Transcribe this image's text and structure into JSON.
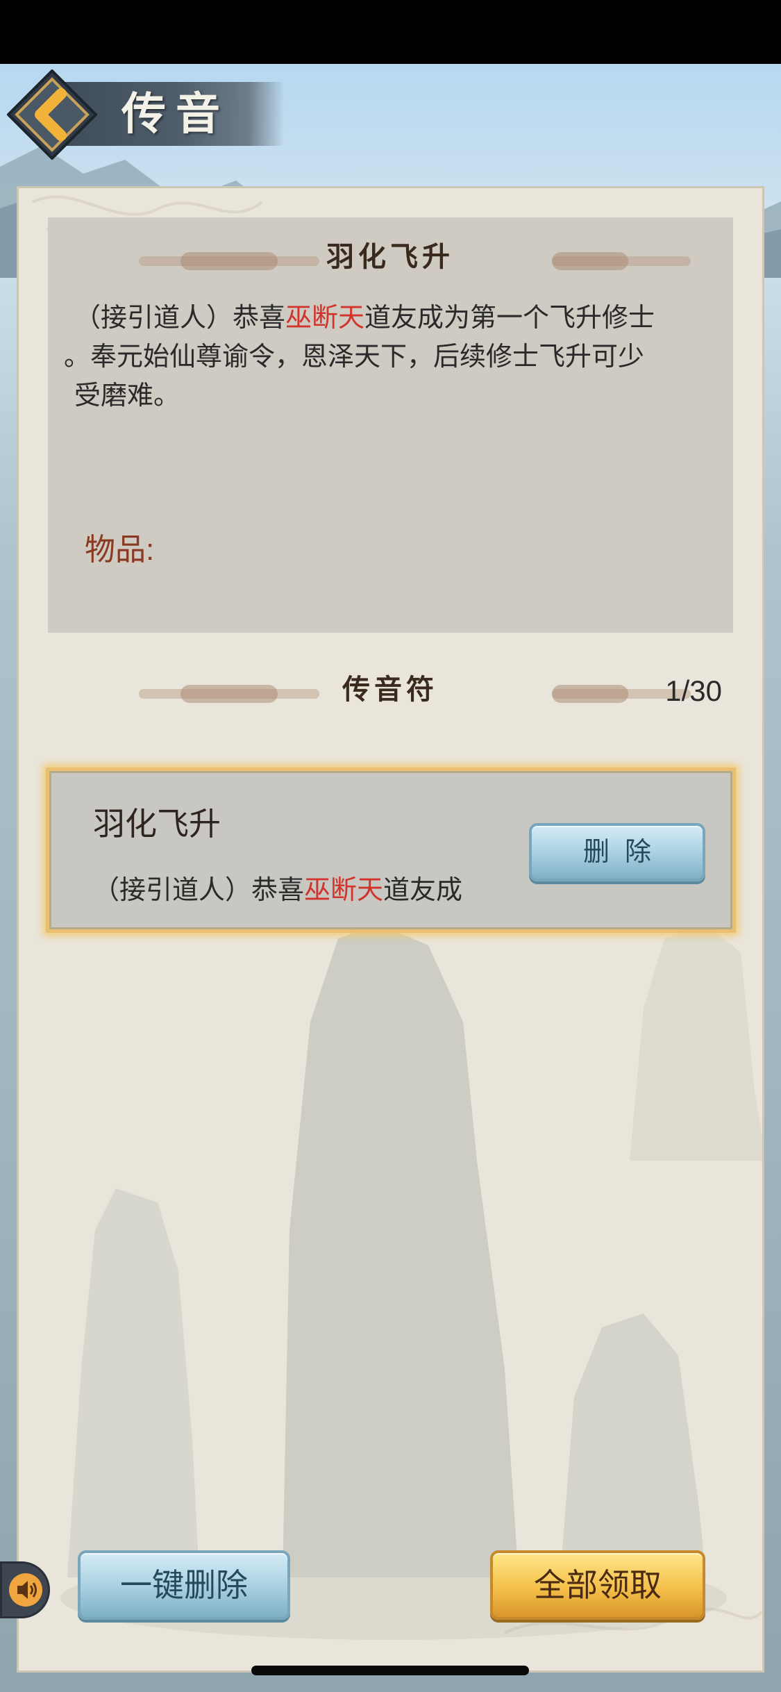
{
  "header": {
    "title": "传音"
  },
  "detail": {
    "section_title": "羽化飞升",
    "body_prefix": "（接引道人）恭喜",
    "body_highlight": "巫断天",
    "body_line1_suffix": "道友成为第一个飞升修士",
    "body_line2": "。奉元始仙尊谕令，恩泽天下，后续修士飞升可少",
    "body_line3": "受磨难。",
    "items_label": "物品:"
  },
  "list": {
    "section_title": "传音符",
    "count": "1/30",
    "items": [
      {
        "title": "羽化飞升",
        "preview_prefix": "（接引道人）恭喜",
        "preview_highlight": "巫断天",
        "preview_suffix": "道友成",
        "delete_label": "删除"
      }
    ]
  },
  "footer": {
    "delete_all_label": "一键删除",
    "claim_all_label": "全部领取"
  },
  "colors": {
    "highlight_red": "#d0342c",
    "selected_border": "#e8c070",
    "paper": "#e9e5da"
  },
  "icons": {
    "back": "chevron-left-icon",
    "sound": "speaker-icon"
  }
}
